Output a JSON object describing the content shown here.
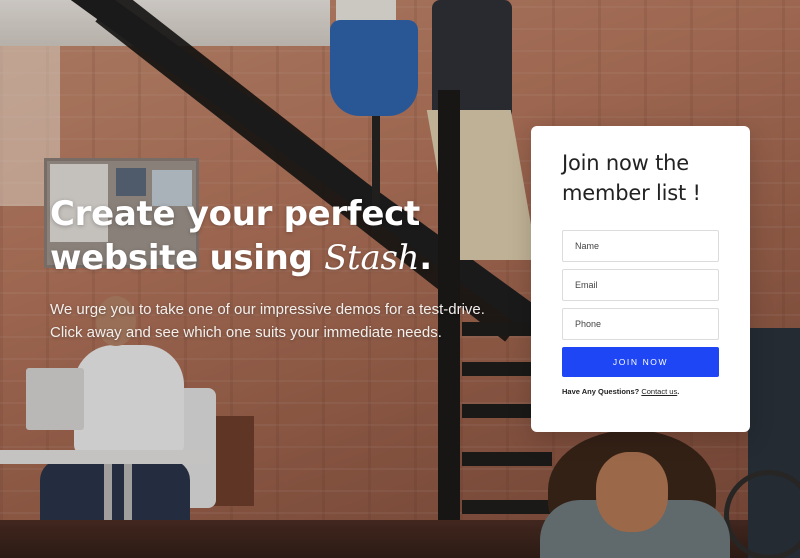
{
  "hero": {
    "title_line1": "Create your perfect",
    "title_line2_prefix": "website using",
    "title_brand": "Stash",
    "title_period": ".",
    "subtitle_line1": "We urge you to take one of our impressive demos for a test-drive.",
    "subtitle_line2": "Click away and see which one suits your immediate needs."
  },
  "signup": {
    "title_line1": "Join now the",
    "title_line2": "member list !",
    "name_placeholder": "Name",
    "email_placeholder": "Email",
    "phone_placeholder": "Phone",
    "button_label": "JOIN NOW",
    "questions_text": "Have Any Questions?",
    "contact_link": "Contact us",
    "contact_suffix": "."
  },
  "colors": {
    "button_bg": "#1e46f5",
    "card_bg": "#ffffff",
    "hero_text": "#ffffff"
  }
}
